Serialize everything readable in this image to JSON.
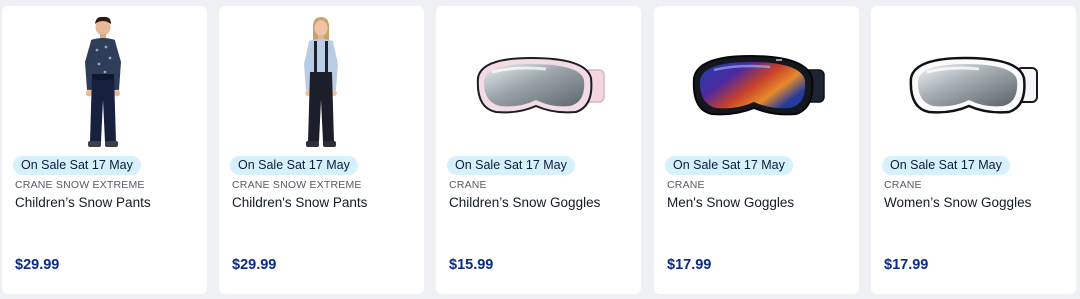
{
  "products": [
    {
      "badge": "On Sale Sat 17 May",
      "brand": "CRANE SNOW EXTREME",
      "title": "Children’s Snow Pants",
      "price": "$29.99",
      "image_icon": "child-snow-pants-image"
    },
    {
      "badge": "On Sale Sat 17 May",
      "brand": "CRANE SNOW EXTREME",
      "title": "Children's Snow Pants",
      "price": "$29.99",
      "image_icon": "child-snow-pants-suspenders-image"
    },
    {
      "badge": "On Sale Sat 17 May",
      "brand": "CRANE",
      "title": "Children’s Snow Goggles",
      "price": "$15.99",
      "image_icon": "pink-goggles-image"
    },
    {
      "badge": "On Sale Sat 17 May",
      "brand": "CRANE",
      "title": "Men's Snow Goggles",
      "price": "$17.99",
      "image_icon": "blue-mirror-goggles-image"
    },
    {
      "badge": "On Sale Sat 17 May",
      "brand": "CRANE",
      "title": "Women’s Snow Goggles",
      "price": "$17.99",
      "image_icon": "white-goggles-image"
    }
  ],
  "colors": {
    "badge_bg": "#d6f1fb",
    "price": "#0b2a87",
    "page_bg": "#eef0f4"
  }
}
